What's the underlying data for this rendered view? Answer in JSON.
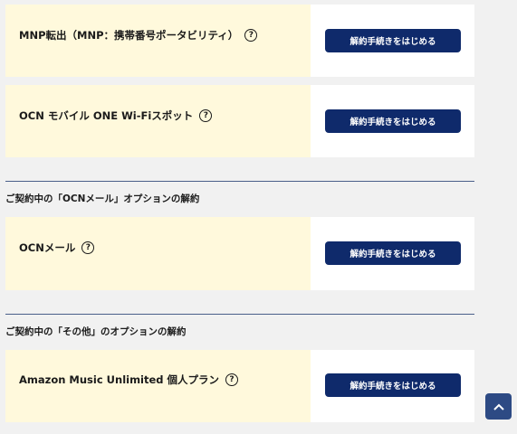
{
  "items": [
    {
      "label": "MNP転出（MNP：携帯番号ポータビリティ）",
      "button": "解約手続きをはじめる"
    },
    {
      "label": "OCN モバイル ONE Wi-Fiスポット",
      "button": "解約手続きをはじめる"
    },
    {
      "label": "OCNメール",
      "button": "解約手続きをはじめる"
    },
    {
      "label": "Amazon Music Unlimited 個人プラン",
      "button": "解約手続きをはじめる"
    }
  ],
  "sections": [
    {
      "heading": "ご契約中の「OCNメール」オプションの解約"
    },
    {
      "heading": "ご契約中の「その他」のオプションの解約"
    }
  ],
  "help_icon": "?",
  "icons": {
    "help": "question-circle-icon",
    "top": "chevron-up-icon"
  },
  "colors": {
    "card_left_bg": "#fff9dc",
    "button_bg": "#0f2a6b",
    "scroll_top_bg": "#2d4a84",
    "page_bg": "#f1f1f1"
  }
}
